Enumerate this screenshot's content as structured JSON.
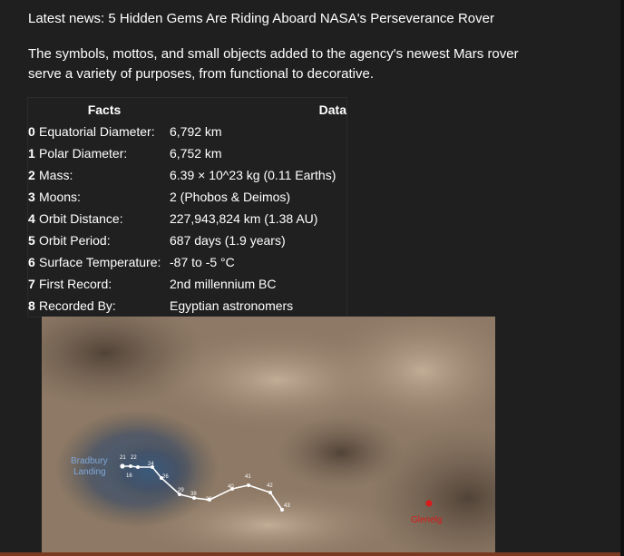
{
  "article": {
    "headline": "Latest news: 5 Hidden Gems Are Riding Aboard NASA's Perseverance Rover",
    "intro": "The symbols, mottos, and small objects added to the agency's newest Mars rover serve a variety of purposes, from functional to decorative."
  },
  "table": {
    "index_header": "",
    "facts_header": "Facts",
    "data_header": "Data",
    "rows": [
      {
        "index": "0",
        "fact": "Equatorial Diameter:",
        "value": "6,792 km"
      },
      {
        "index": "1",
        "fact": "Polar Diameter:",
        "value": "6,752 km"
      },
      {
        "index": "2",
        "fact": "Mass:",
        "value": "6.39 × 10^23 kg (0.11 Earths)"
      },
      {
        "index": "3",
        "fact": "Moons:",
        "value": "2 (Phobos & Deimos)"
      },
      {
        "index": "4",
        "fact": "Orbit Distance:",
        "value": "227,943,824 km (1.38 AU)"
      },
      {
        "index": "5",
        "fact": "Orbit Period:",
        "value": "687 days (1.9 years)"
      },
      {
        "index": "6",
        "fact": "Surface Temperature:",
        "value": "-87 to -5 °C"
      },
      {
        "index": "7",
        "fact": "First Record:",
        "value": "2nd millennium BC"
      },
      {
        "index": "8",
        "fact": "Recorded By:",
        "value": "Egyptian astronomers"
      }
    ]
  },
  "map": {
    "landing_label_line1": "Bradbury",
    "landing_label_line2": "Landing",
    "target_label": "Glenelg",
    "sol_labels": [
      "21",
      "22",
      "16",
      "24",
      "26",
      "29",
      "38",
      "39",
      "40",
      "41",
      "42",
      "43"
    ],
    "colors": {
      "terrain": "#8d7965",
      "terrain_dark": "#5a4a3e",
      "landing_zone": "#3e4f63",
      "landing_label": "#7fa8d6",
      "traverse": "#ffffff",
      "target": "#d81b1b"
    }
  },
  "theme": {
    "background": "#1f1f1f",
    "text": "#ffffff",
    "accent_strip": "#7a3a22"
  }
}
